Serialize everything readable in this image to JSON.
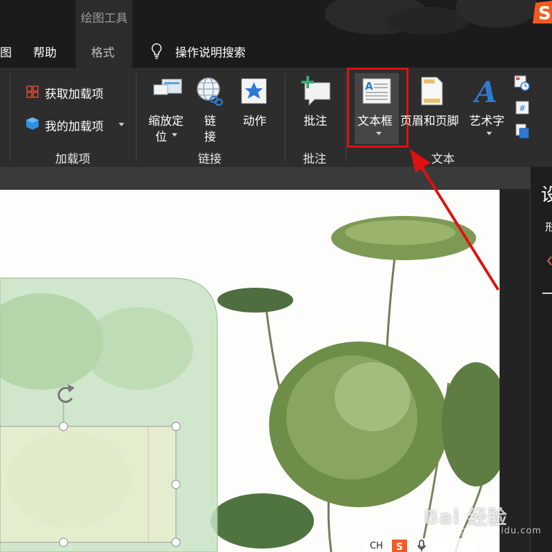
{
  "tabs": {
    "context_label": "绘图工具",
    "partial_left": "图",
    "help": "帮助",
    "format": "格式",
    "tell_me": "操作说明搜索"
  },
  "ribbon": {
    "addins": {
      "get_addins": "获取加载项",
      "my_addins": "我的加载项",
      "group_label": "加载项"
    },
    "links": {
      "zoom_line1": "缩放定",
      "zoom_line2": "位",
      "link_line1": "链",
      "link_line2": "接",
      "action": "动作",
      "group_label": "链接"
    },
    "comments": {
      "comment": "批注",
      "group_label": "批注"
    },
    "text": {
      "text_box": "文本框",
      "header_footer": "页眉和页脚",
      "wordart": "艺术字",
      "group_label": "文本"
    }
  },
  "side_pane": {
    "title": "设",
    "sub": "形"
  },
  "watermark": {
    "brand": "Bai 经验",
    "url": "jingyan.baidu.com"
  },
  "ime": {
    "text": "CH"
  },
  "colors": {
    "highlight_red": "#e01010",
    "selected_shape_green": "#c9e3c4",
    "ribbon_bg": "#2d2d2d"
  }
}
